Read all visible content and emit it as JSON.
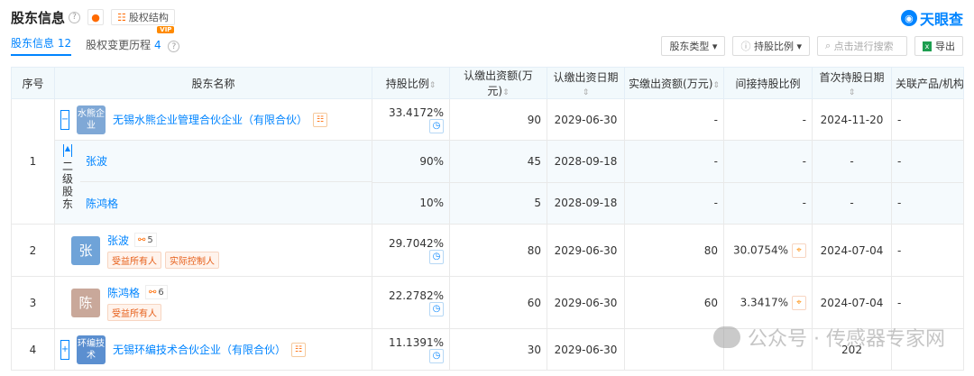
{
  "header": {
    "title": "股东信息",
    "struct_label": "股权结构",
    "logo_text": "天眼查"
  },
  "tabs": [
    {
      "label": "股东信息",
      "count": "12"
    },
    {
      "label": "股权变更历程",
      "count": "4",
      "badge": "VIP"
    }
  ],
  "tools": {
    "type_label": "股东类型",
    "ratio_label": "持股比例",
    "search_placeholder": "点击进行搜索",
    "export_label": "导出"
  },
  "columns": [
    "序号",
    "股东名称",
    "持股比例",
    "认缴出资额(万元)",
    "认缴出资日期",
    "实缴出资额(万元)",
    "间接持股比例",
    "首次持股日期",
    "关联产品/机构"
  ],
  "rows": [
    {
      "no": "1",
      "logo": "水熊企业",
      "name": "无锡水熊企业管理合伙企业（有限合伙）",
      "ratio": "33.4172%",
      "sub_amt": "90",
      "sub_date": "2029-06-30",
      "paid": "-",
      "indirect": "-",
      "first": "2024-11-20",
      "prod": "-"
    },
    {
      "tier": "二级股东",
      "name": "张波",
      "ratio": "90%",
      "sub_amt": "45",
      "sub_date": "2028-09-18",
      "paid": "-",
      "indirect": "-",
      "first": "-",
      "prod": "-"
    },
    {
      "name": "陈鸿格",
      "ratio": "10%",
      "sub_amt": "5",
      "sub_date": "2028-09-18",
      "paid": "-",
      "indirect": "-",
      "first": "-",
      "prod": "-"
    },
    {
      "no": "2",
      "avatar": "张",
      "name": "张波",
      "rel": "5",
      "tags": [
        "受益所有人",
        "实际控制人"
      ],
      "ratio": "29.7042%",
      "sub_amt": "80",
      "sub_date": "2029-06-30",
      "paid": "80",
      "indirect": "30.0754%",
      "first": "2024-07-04",
      "prod": "-"
    },
    {
      "no": "3",
      "avatar": "陈",
      "name": "陈鸿格",
      "rel": "6",
      "tags": [
        "受益所有人"
      ],
      "ratio": "22.2782%",
      "sub_amt": "60",
      "sub_date": "2029-06-30",
      "paid": "60",
      "indirect": "3.3417%",
      "first": "2024-07-04",
      "prod": "-"
    },
    {
      "no": "4",
      "logo": "环编技术",
      "name": "无锡环编技术合伙企业（有限合伙）",
      "ratio": "11.1391%",
      "sub_amt": "30",
      "sub_date": "2029-06-30",
      "paid": "",
      "indirect": "",
      "first": "202",
      "prod": ""
    }
  ],
  "watermark": "公众号 · 传感器专家网",
  "colors": {
    "accent": "#0084ff",
    "orange": "#ff6a00"
  }
}
